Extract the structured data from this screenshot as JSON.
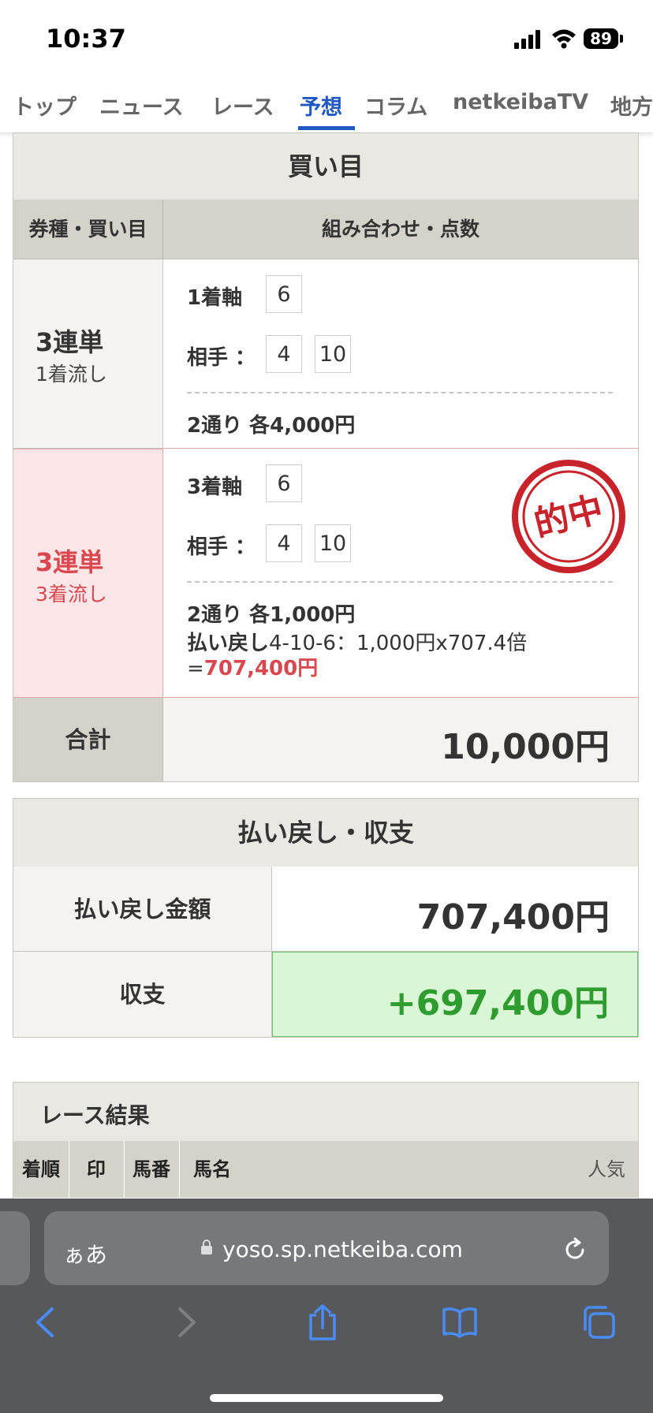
{
  "status": {
    "time": "10:37",
    "battery": "89"
  },
  "tabs": [
    "トップ",
    "ニュース",
    "レース",
    "予想",
    "コラム",
    "netkeibaTV",
    "地方"
  ],
  "bets": {
    "title": "買い目",
    "col_type": "券種・買い目",
    "col_combo": "組み合わせ・点数",
    "rows": [
      {
        "type": "3連単",
        "method": "1着流し",
        "axis_label": "1着軸",
        "axis": "6",
        "partner_label": "相手 ：",
        "partners": [
          "4",
          "10"
        ],
        "summary": "2通り 各4,000円"
      },
      {
        "type": "3連単",
        "method": "3着流し",
        "axis_label": "3着軸",
        "axis": "6",
        "partner_label": "相手 ：",
        "partners": [
          "4",
          "10"
        ],
        "summary": "2通り 各1,000円",
        "payout_label": "払い戻し",
        "payout_detail": "4-10-6：1,000円x707.4倍",
        "payout_eq": "=",
        "payout_value": "707,400円",
        "hit_stamp": "的中"
      }
    ],
    "total_label": "合計",
    "total_value": "10,000円"
  },
  "payout": {
    "title": "払い戻し・収支",
    "amount_label": "払い戻し金額",
    "amount_value": "707,400円",
    "balance_label": "収支",
    "balance_value": "+697,400円"
  },
  "results": {
    "title": "レース結果",
    "columns": [
      "着順",
      "印",
      "馬番",
      "馬名",
      "人気"
    ]
  },
  "browser": {
    "aa": "ぁあ",
    "url": "yoso.sp.netkeiba.com"
  }
}
